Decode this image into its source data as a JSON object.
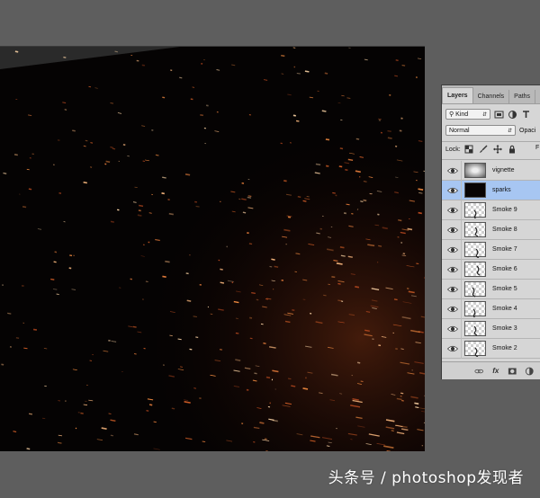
{
  "panel": {
    "tabs": [
      {
        "label": "Layers",
        "active": true
      },
      {
        "label": "Channels",
        "active": false
      },
      {
        "label": "Paths",
        "active": false
      }
    ],
    "filter_kind": "Kind",
    "blend_mode": "Normal",
    "opacity_label": "Opaci",
    "lock_label": "Lock:",
    "fill_label": "F",
    "layers": [
      {
        "name": "vignette",
        "thumb": "vignette",
        "selected": false
      },
      {
        "name": "sparks",
        "thumb": "dark",
        "selected": true
      },
      {
        "name": "Smoke 9",
        "thumb": "transparent",
        "selected": false
      },
      {
        "name": "Smoke 8",
        "thumb": "transparent",
        "selected": false
      },
      {
        "name": "Smoke 7",
        "thumb": "transparent",
        "selected": false
      },
      {
        "name": "Smoke 6",
        "thumb": "transparent",
        "selected": false
      },
      {
        "name": "Smoke 5",
        "thumb": "transparent",
        "selected": false
      },
      {
        "name": "Smoke 4",
        "thumb": "transparent",
        "selected": false
      },
      {
        "name": "Smoke 3",
        "thumb": "transparent",
        "selected": false
      },
      {
        "name": "Smoke 2",
        "thumb": "transparent",
        "selected": false
      }
    ],
    "bottom_icons": [
      "link-icon",
      "fx-icon",
      "mask-icon",
      "adjustment-icon"
    ],
    "fx_label": "fx"
  },
  "watermark": "头条号 / photoshop发现者",
  "colors": {
    "workspace": "#5e5e5e",
    "canvas": "#050303",
    "panel": "#d6d6d6",
    "selected_row": "#a7c6f2",
    "spark_orange": "#e07a3a",
    "spark_warm": "#f2b27a"
  }
}
